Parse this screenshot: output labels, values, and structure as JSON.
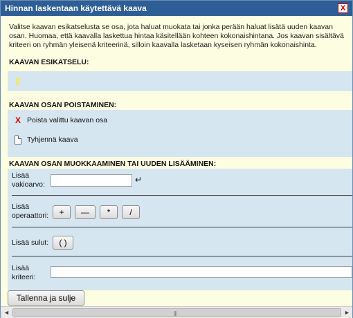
{
  "window": {
    "title": "Hinnan laskentaan käytettävä kaava",
    "close_label": "X"
  },
  "intro_lines": [
    "Valitse kaavan esikatselusta se osa, jota haluat muokata tai jonka perään haluat lisätä uuden kaavan",
    "osan. Huomaa, että kaavalla laskettua hintaa käsitellään kohteen kokonaishintana. Jos kaavan sisältävä",
    "kriteeri on ryhmän yleisenä kriteerinä, silloin kaavalla lasketaan kyseisen ryhmän kokonaishinta."
  ],
  "preview": {
    "heading": "KAAVAN ESIKATSELU:"
  },
  "remove": {
    "heading": "KAAVAN OSAN POISTAMINEN:",
    "delete_label": "Poista valittu kaavan osa",
    "clear_label": "Tyhjennä kaava",
    "delete_icon": "x-icon",
    "clear_icon": "page-icon"
  },
  "edit": {
    "heading": "KAAVAN OSAN MUOKKAAMINEN TAI UUDEN LISÄÄMINEN:",
    "constant_label_1": "Lisää",
    "constant_label_2": "vakioarvo:",
    "constant_value": "",
    "enter_icon": "↵",
    "operator_label_1": "Lisää",
    "operator_label_2": "operaattori:",
    "operators": [
      "+",
      "—",
      "*",
      "/"
    ],
    "brackets_label": "Lisää sulut:",
    "brackets_button": "( )",
    "criterion_label_1": "Lisää",
    "criterion_label_2": "kriteeri:",
    "criterion_selected": ""
  },
  "footer": {
    "save_label": "Tallenna ja sulje"
  },
  "colors": {
    "titlebar": "#2e5e96",
    "background": "#fdfde1",
    "panel": "#d6e6f1",
    "close_red": "#d00000"
  }
}
